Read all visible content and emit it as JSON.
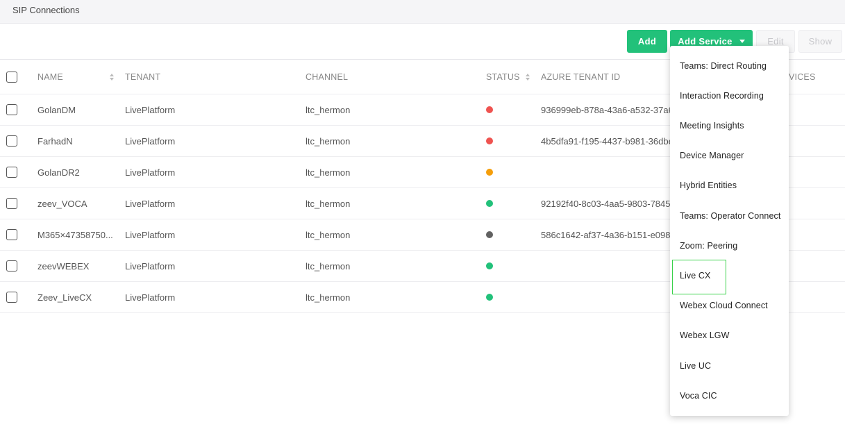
{
  "page": {
    "title": "SIP Connections"
  },
  "toolbar": {
    "add_label": "Add",
    "add_service_label": "Add Service",
    "edit_label": "Edit",
    "show_label": "Show"
  },
  "table": {
    "headers": {
      "name": "NAME",
      "tenant": "TENANT",
      "channel": "CHANNEL",
      "status": "STATUS",
      "azure_tenant_id": "AZURE TENANT ID",
      "services_partial": "VICES"
    },
    "rows": [
      {
        "name": "GolanDM",
        "tenant": "LivePlatform",
        "channel": "ltc_hermon",
        "status": "red",
        "azure": "936999eb-878a-43a6-a532-37a6"
      },
      {
        "name": "FarhadN",
        "tenant": "LivePlatform",
        "channel": "ltc_hermon",
        "status": "red",
        "azure": "4b5dfa91-f195-4437-b981-36dbe"
      },
      {
        "name": "GolanDR2",
        "tenant": "LivePlatform",
        "channel": "ltc_hermon",
        "status": "orange",
        "azure": ""
      },
      {
        "name": "zeev_VOCA",
        "tenant": "LivePlatform",
        "channel": "ltc_hermon",
        "status": "green",
        "azure": "92192f40-8c03-4aa5-9803-7845"
      },
      {
        "name": "M365×47358750...",
        "tenant": "LivePlatform",
        "channel": "ltc_hermon",
        "status": "gray",
        "azure": "586c1642-af37-4a36-b151-e0985"
      },
      {
        "name": "zeevWEBEX",
        "tenant": "LivePlatform",
        "channel": "ltc_hermon",
        "status": "green",
        "azure": ""
      },
      {
        "name": "Zeev_LiveCX",
        "tenant": "LivePlatform",
        "channel": "ltc_hermon",
        "status": "green",
        "azure": ""
      }
    ]
  },
  "status_colors": {
    "red": "#ef5350",
    "orange": "#f59e0b",
    "green": "#22c17a",
    "gray": "#616161"
  },
  "accent_color": "#22c17a",
  "add_service_menu": {
    "items": [
      "Teams: Direct Routing",
      "Interaction Recording",
      "Meeting Insights",
      "Device Manager",
      "Hybrid Entities",
      "Teams: Operator Connect",
      "Zoom: Peering",
      "Live CX",
      "Webex Cloud Connect",
      "Webex LGW",
      "Live UC",
      "Voca CIC"
    ],
    "highlighted": "Live CX"
  }
}
